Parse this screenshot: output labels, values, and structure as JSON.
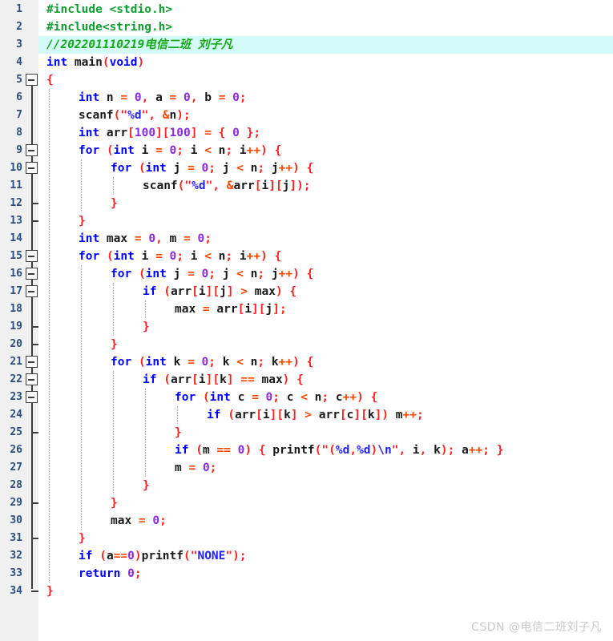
{
  "editor": {
    "language": "C",
    "gutter_bg": "#f0f0f0",
    "background": "#ffffff",
    "highlight_color": "#d5fafa",
    "linenumber_color": "#2b4d7e",
    "first_line": 1,
    "last_line": 34,
    "line_height": 22
  },
  "watermark": {
    "text": "CSDN @电信二班刘子凡",
    "color": "#c8c8c8"
  },
  "lines": [
    {
      "num": "1",
      "fold": "none",
      "indent": 0,
      "text": "#include <stdio.h>"
    },
    {
      "num": "2",
      "fold": "none",
      "indent": 0,
      "text": "#include<string.h>"
    },
    {
      "num": "3",
      "fold": "none",
      "indent": 0,
      "highlight": true,
      "text": "//202201110219电信二班 刘子凡"
    },
    {
      "num": "4",
      "fold": "none",
      "indent": 0,
      "text": "int main(void)"
    },
    {
      "num": "5",
      "fold": "box",
      "indent": 0,
      "text": "{"
    },
    {
      "num": "6",
      "fold": "bar",
      "indent": 1,
      "text": "int n = 0, a = 0, b = 0;"
    },
    {
      "num": "7",
      "fold": "bar",
      "indent": 1,
      "text": "scanf(\"%d\", &n);"
    },
    {
      "num": "8",
      "fold": "bar",
      "indent": 1,
      "text": "int arr[100][100] = { 0 };"
    },
    {
      "num": "9",
      "fold": "box",
      "indent": 1,
      "text": "for (int i = 0; i < n; i++) {"
    },
    {
      "num": "10",
      "fold": "box",
      "indent": 2,
      "text": "for (int j = 0; j < n; j++) {"
    },
    {
      "num": "11",
      "fold": "bar",
      "indent": 3,
      "text": "scanf(\"%d\", &arr[i][j]);"
    },
    {
      "num": "12",
      "fold": "tick",
      "indent": 2,
      "text": "}"
    },
    {
      "num": "13",
      "fold": "tick",
      "indent": 1,
      "text": "}"
    },
    {
      "num": "14",
      "fold": "bar",
      "indent": 1,
      "text": "int max = 0, m = 0;"
    },
    {
      "num": "15",
      "fold": "box",
      "indent": 1,
      "text": "for (int i = 0; i < n; i++) {"
    },
    {
      "num": "16",
      "fold": "box",
      "indent": 2,
      "text": "for (int j = 0; j < n; j++) {"
    },
    {
      "num": "17",
      "fold": "box",
      "indent": 3,
      "text": "if (arr[i][j] > max) {"
    },
    {
      "num": "18",
      "fold": "bar",
      "indent": 4,
      "text": "max = arr[i][j];"
    },
    {
      "num": "19",
      "fold": "tick",
      "indent": 3,
      "text": "}"
    },
    {
      "num": "20",
      "fold": "tick",
      "indent": 2,
      "text": "}"
    },
    {
      "num": "21",
      "fold": "box",
      "indent": 2,
      "text": "for (int k = 0; k < n; k++) {"
    },
    {
      "num": "22",
      "fold": "box",
      "indent": 3,
      "text": "if (arr[i][k] == max) {"
    },
    {
      "num": "23",
      "fold": "box",
      "indent": 4,
      "text": "for (int c = 0; c < n; c++) {"
    },
    {
      "num": "24",
      "fold": "bar",
      "indent": 5,
      "text": "if (arr[i][k] > arr[c][k]) m++;"
    },
    {
      "num": "25",
      "fold": "tick",
      "indent": 4,
      "text": "}"
    },
    {
      "num": "26",
      "fold": "bar",
      "indent": 4,
      "text": "if (m == 0) { printf(\"(%d,%d)\\n\", i, k); a++; }"
    },
    {
      "num": "27",
      "fold": "bar",
      "indent": 4,
      "text": "m = 0;"
    },
    {
      "num": "28",
      "fold": "bar",
      "indent": 3,
      "text": "}"
    },
    {
      "num": "29",
      "fold": "tick",
      "indent": 2,
      "text": "}"
    },
    {
      "num": "30",
      "fold": "bar",
      "indent": 2,
      "text": "max = 0;"
    },
    {
      "num": "31",
      "fold": "tick",
      "indent": 1,
      "text": "}"
    },
    {
      "num": "32",
      "fold": "bar",
      "indent": 1,
      "text": "if (a==0)printf(\"NONE\");"
    },
    {
      "num": "33",
      "fold": "bar",
      "indent": 1,
      "text": "return 0;"
    },
    {
      "num": "34",
      "fold": "end",
      "indent": 0,
      "text": "}"
    }
  ],
  "tokens": {
    "1": [
      [
        "#include ",
        "pre"
      ],
      [
        "<stdio.h>",
        "pre"
      ]
    ],
    "2": [
      [
        "#include<string.h>",
        "pre"
      ]
    ],
    "3": [
      [
        "//202201110219电信二班 刘子凡",
        "cmt"
      ]
    ],
    "4": [
      [
        "int",
        "kw"
      ],
      [
        " main",
        "id"
      ],
      [
        "(",
        "punc"
      ],
      [
        "void",
        "kw"
      ],
      [
        ")",
        "punc"
      ]
    ],
    "5": [
      [
        "{",
        "punc"
      ]
    ],
    "6": [
      [
        "int",
        "kw"
      ],
      [
        " n ",
        "id"
      ],
      [
        "=",
        "op"
      ],
      [
        " ",
        "id"
      ],
      [
        "0",
        "num"
      ],
      [
        ",",
        "punc"
      ],
      [
        " a ",
        "id"
      ],
      [
        "=",
        "op"
      ],
      [
        " ",
        "id"
      ],
      [
        "0",
        "num"
      ],
      [
        ",",
        "punc"
      ],
      [
        " b ",
        "id"
      ],
      [
        "=",
        "op"
      ],
      [
        " ",
        "id"
      ],
      [
        "0",
        "num"
      ],
      [
        ";",
        "punc"
      ]
    ],
    "7": [
      [
        "scanf",
        "id"
      ],
      [
        "(",
        "punc"
      ],
      [
        "\"",
        "str"
      ],
      [
        "%d",
        "fmt"
      ],
      [
        "\"",
        "str"
      ],
      [
        ",",
        "punc"
      ],
      [
        " ",
        "id"
      ],
      [
        "&",
        "op"
      ],
      [
        "n",
        "id"
      ],
      [
        ")",
        "punc"
      ],
      [
        ";",
        "punc"
      ]
    ],
    "8": [
      [
        "int",
        "kw"
      ],
      [
        " arr",
        "id"
      ],
      [
        "[",
        "punc"
      ],
      [
        "100",
        "num"
      ],
      [
        "]",
        "punc"
      ],
      [
        "[",
        "punc"
      ],
      [
        "100",
        "num"
      ],
      [
        "]",
        "punc"
      ],
      [
        " ",
        "id"
      ],
      [
        "=",
        "op"
      ],
      [
        " ",
        "id"
      ],
      [
        "{",
        "punc"
      ],
      [
        " ",
        "id"
      ],
      [
        "0",
        "num"
      ],
      [
        " ",
        "id"
      ],
      [
        "}",
        "punc"
      ],
      [
        ";",
        "punc"
      ]
    ],
    "9": [
      [
        "for",
        "kw"
      ],
      [
        " ",
        "id"
      ],
      [
        "(",
        "punc"
      ],
      [
        "int",
        "kw"
      ],
      [
        " i ",
        "id"
      ],
      [
        "=",
        "op"
      ],
      [
        " ",
        "id"
      ],
      [
        "0",
        "num"
      ],
      [
        ";",
        "punc"
      ],
      [
        " i ",
        "id"
      ],
      [
        "<",
        "op"
      ],
      [
        " n",
        "id"
      ],
      [
        ";",
        "punc"
      ],
      [
        " i",
        "id"
      ],
      [
        "++",
        "op"
      ],
      [
        ")",
        "punc"
      ],
      [
        " ",
        "id"
      ],
      [
        "{",
        "punc"
      ]
    ],
    "10": [
      [
        "for",
        "kw"
      ],
      [
        " ",
        "id"
      ],
      [
        "(",
        "punc"
      ],
      [
        "int",
        "kw"
      ],
      [
        " j ",
        "id"
      ],
      [
        "=",
        "op"
      ],
      [
        " ",
        "id"
      ],
      [
        "0",
        "num"
      ],
      [
        ";",
        "punc"
      ],
      [
        " j ",
        "id"
      ],
      [
        "<",
        "op"
      ],
      [
        " n",
        "id"
      ],
      [
        ";",
        "punc"
      ],
      [
        " j",
        "id"
      ],
      [
        "++",
        "op"
      ],
      [
        ")",
        "punc"
      ],
      [
        " ",
        "id"
      ],
      [
        "{",
        "punc"
      ]
    ],
    "11": [
      [
        "scanf",
        "id"
      ],
      [
        "(",
        "punc"
      ],
      [
        "\"",
        "str"
      ],
      [
        "%d",
        "fmt"
      ],
      [
        "\"",
        "str"
      ],
      [
        ",",
        "punc"
      ],
      [
        " ",
        "id"
      ],
      [
        "&",
        "op"
      ],
      [
        "arr",
        "id"
      ],
      [
        "[",
        "punc"
      ],
      [
        "i",
        "id"
      ],
      [
        "]",
        "punc"
      ],
      [
        "[",
        "punc"
      ],
      [
        "j",
        "id"
      ],
      [
        "]",
        "punc"
      ],
      [
        ")",
        "punc"
      ],
      [
        ";",
        "punc"
      ]
    ],
    "12": [
      [
        "}",
        "punc"
      ]
    ],
    "13": [
      [
        "}",
        "punc"
      ]
    ],
    "14": [
      [
        "int",
        "kw"
      ],
      [
        " max ",
        "id"
      ],
      [
        "=",
        "op"
      ],
      [
        " ",
        "id"
      ],
      [
        "0",
        "num"
      ],
      [
        ",",
        "punc"
      ],
      [
        " m ",
        "id"
      ],
      [
        "=",
        "op"
      ],
      [
        " ",
        "id"
      ],
      [
        "0",
        "num"
      ],
      [
        ";",
        "punc"
      ]
    ],
    "15": [
      [
        "for",
        "kw"
      ],
      [
        " ",
        "id"
      ],
      [
        "(",
        "punc"
      ],
      [
        "int",
        "kw"
      ],
      [
        " i ",
        "id"
      ],
      [
        "=",
        "op"
      ],
      [
        " ",
        "id"
      ],
      [
        "0",
        "num"
      ],
      [
        ";",
        "punc"
      ],
      [
        " i ",
        "id"
      ],
      [
        "<",
        "op"
      ],
      [
        " n",
        "id"
      ],
      [
        ";",
        "punc"
      ],
      [
        " i",
        "id"
      ],
      [
        "++",
        "op"
      ],
      [
        ")",
        "punc"
      ],
      [
        " ",
        "id"
      ],
      [
        "{",
        "punc"
      ]
    ],
    "16": [
      [
        "for",
        "kw"
      ],
      [
        " ",
        "id"
      ],
      [
        "(",
        "punc"
      ],
      [
        "int",
        "kw"
      ],
      [
        " j ",
        "id"
      ],
      [
        "=",
        "op"
      ],
      [
        " ",
        "id"
      ],
      [
        "0",
        "num"
      ],
      [
        ";",
        "punc"
      ],
      [
        " j ",
        "id"
      ],
      [
        "<",
        "op"
      ],
      [
        " n",
        "id"
      ],
      [
        ";",
        "punc"
      ],
      [
        " j",
        "id"
      ],
      [
        "++",
        "op"
      ],
      [
        ")",
        "punc"
      ],
      [
        " ",
        "id"
      ],
      [
        "{",
        "punc"
      ]
    ],
    "17": [
      [
        "if",
        "kw"
      ],
      [
        " ",
        "id"
      ],
      [
        "(",
        "punc"
      ],
      [
        "arr",
        "id"
      ],
      [
        "[",
        "punc"
      ],
      [
        "i",
        "id"
      ],
      [
        "]",
        "punc"
      ],
      [
        "[",
        "punc"
      ],
      [
        "j",
        "id"
      ],
      [
        "]",
        "punc"
      ],
      [
        " ",
        "id"
      ],
      [
        ">",
        "op"
      ],
      [
        " max",
        "id"
      ],
      [
        ")",
        "punc"
      ],
      [
        " ",
        "id"
      ],
      [
        "{",
        "punc"
      ]
    ],
    "18": [
      [
        "max ",
        "id"
      ],
      [
        "=",
        "op"
      ],
      [
        " arr",
        "id"
      ],
      [
        "[",
        "punc"
      ],
      [
        "i",
        "id"
      ],
      [
        "]",
        "punc"
      ],
      [
        "[",
        "punc"
      ],
      [
        "j",
        "id"
      ],
      [
        "]",
        "punc"
      ],
      [
        ";",
        "punc"
      ]
    ],
    "19": [
      [
        "}",
        "punc"
      ]
    ],
    "20": [
      [
        "}",
        "punc"
      ]
    ],
    "21": [
      [
        "for",
        "kw"
      ],
      [
        " ",
        "id"
      ],
      [
        "(",
        "punc"
      ],
      [
        "int",
        "kw"
      ],
      [
        " k ",
        "id"
      ],
      [
        "=",
        "op"
      ],
      [
        " ",
        "id"
      ],
      [
        "0",
        "num"
      ],
      [
        ";",
        "punc"
      ],
      [
        " k ",
        "id"
      ],
      [
        "<",
        "op"
      ],
      [
        " n",
        "id"
      ],
      [
        ";",
        "punc"
      ],
      [
        " k",
        "id"
      ],
      [
        "++",
        "op"
      ],
      [
        ")",
        "punc"
      ],
      [
        " ",
        "id"
      ],
      [
        "{",
        "punc"
      ]
    ],
    "22": [
      [
        "if",
        "kw"
      ],
      [
        " ",
        "id"
      ],
      [
        "(",
        "punc"
      ],
      [
        "arr",
        "id"
      ],
      [
        "[",
        "punc"
      ],
      [
        "i",
        "id"
      ],
      [
        "]",
        "punc"
      ],
      [
        "[",
        "punc"
      ],
      [
        "k",
        "id"
      ],
      [
        "]",
        "punc"
      ],
      [
        " ",
        "id"
      ],
      [
        "==",
        "op"
      ],
      [
        " max",
        "id"
      ],
      [
        ")",
        "punc"
      ],
      [
        " ",
        "id"
      ],
      [
        "{",
        "punc"
      ]
    ],
    "23": [
      [
        "for",
        "kw"
      ],
      [
        " ",
        "id"
      ],
      [
        "(",
        "punc"
      ],
      [
        "int",
        "kw"
      ],
      [
        " c ",
        "id"
      ],
      [
        "=",
        "op"
      ],
      [
        " ",
        "id"
      ],
      [
        "0",
        "num"
      ],
      [
        ";",
        "punc"
      ],
      [
        " c ",
        "id"
      ],
      [
        "<",
        "op"
      ],
      [
        " n",
        "id"
      ],
      [
        ";",
        "punc"
      ],
      [
        " c",
        "id"
      ],
      [
        "++",
        "op"
      ],
      [
        ")",
        "punc"
      ],
      [
        " ",
        "id"
      ],
      [
        "{",
        "punc"
      ]
    ],
    "24": [
      [
        "if",
        "kw"
      ],
      [
        " ",
        "id"
      ],
      [
        "(",
        "punc"
      ],
      [
        "arr",
        "id"
      ],
      [
        "[",
        "punc"
      ],
      [
        "i",
        "id"
      ],
      [
        "]",
        "punc"
      ],
      [
        "[",
        "punc"
      ],
      [
        "k",
        "id"
      ],
      [
        "]",
        "punc"
      ],
      [
        " ",
        "id"
      ],
      [
        ">",
        "op"
      ],
      [
        " arr",
        "id"
      ],
      [
        "[",
        "punc"
      ],
      [
        "c",
        "id"
      ],
      [
        "]",
        "punc"
      ],
      [
        "[",
        "punc"
      ],
      [
        "k",
        "id"
      ],
      [
        "]",
        "punc"
      ],
      [
        ")",
        "punc"
      ],
      [
        " m",
        "id"
      ],
      [
        "++",
        "op"
      ],
      [
        ";",
        "punc"
      ]
    ],
    "25": [
      [
        "}",
        "punc"
      ]
    ],
    "26": [
      [
        "if",
        "kw"
      ],
      [
        " ",
        "id"
      ],
      [
        "(",
        "punc"
      ],
      [
        "m ",
        "id"
      ],
      [
        "==",
        "op"
      ],
      [
        " ",
        "id"
      ],
      [
        "0",
        "num"
      ],
      [
        ")",
        "punc"
      ],
      [
        " ",
        "id"
      ],
      [
        "{",
        "punc"
      ],
      [
        " printf",
        "id"
      ],
      [
        "(",
        "punc"
      ],
      [
        "\"(",
        "str"
      ],
      [
        "%d",
        "fmt"
      ],
      [
        ",",
        "str"
      ],
      [
        "%d",
        "fmt"
      ],
      [
        ")",
        "str"
      ],
      [
        "\\n",
        "fmt"
      ],
      [
        "\"",
        "str"
      ],
      [
        ",",
        "punc"
      ],
      [
        " i",
        "id"
      ],
      [
        ",",
        "punc"
      ],
      [
        " k",
        "id"
      ],
      [
        ")",
        "punc"
      ],
      [
        ";",
        "punc"
      ],
      [
        " a",
        "id"
      ],
      [
        "++",
        "op"
      ],
      [
        ";",
        "punc"
      ],
      [
        " ",
        "id"
      ],
      [
        "}",
        "punc"
      ]
    ],
    "27": [
      [
        "m ",
        "id"
      ],
      [
        "=",
        "op"
      ],
      [
        " ",
        "id"
      ],
      [
        "0",
        "num"
      ],
      [
        ";",
        "punc"
      ]
    ],
    "28": [
      [
        "}",
        "punc"
      ]
    ],
    "29": [
      [
        "}",
        "punc"
      ]
    ],
    "30": [
      [
        "max ",
        "id"
      ],
      [
        "=",
        "op"
      ],
      [
        " ",
        "id"
      ],
      [
        "0",
        "num"
      ],
      [
        ";",
        "punc"
      ]
    ],
    "31": [
      [
        "}",
        "punc"
      ]
    ],
    "32": [
      [
        "if",
        "kw"
      ],
      [
        " ",
        "id"
      ],
      [
        "(",
        "punc"
      ],
      [
        "a",
        "id"
      ],
      [
        "==",
        "op"
      ],
      [
        "0",
        "num"
      ],
      [
        ")",
        "punc"
      ],
      [
        "printf",
        "id"
      ],
      [
        "(",
        "punc"
      ],
      [
        "\"",
        "str"
      ],
      [
        "NONE",
        "fmt"
      ],
      [
        "\"",
        "str"
      ],
      [
        ")",
        "punc"
      ],
      [
        ";",
        "punc"
      ]
    ],
    "33": [
      [
        "return",
        "kw"
      ],
      [
        " ",
        "id"
      ],
      [
        "0",
        "num"
      ],
      [
        ";",
        "punc"
      ]
    ],
    "34": [
      [
        "}",
        "punc"
      ]
    ]
  }
}
